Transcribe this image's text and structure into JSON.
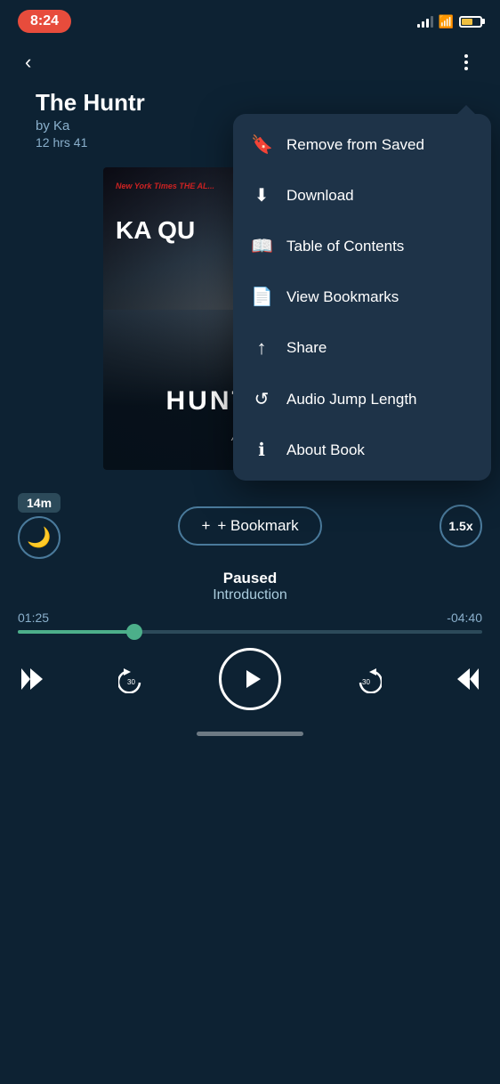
{
  "statusBar": {
    "time": "8:24",
    "batteryColor": "#f0c040"
  },
  "header": {
    "backLabel": "‹",
    "moreLabel": "⋮"
  },
  "book": {
    "title": "The Huntr",
    "fullTitle": "The Huntress",
    "author": "by Ka",
    "fullAuthor": "by Kate Quinn",
    "duration": "12 hrs 41",
    "coverTopText": "New York Times\nTHE AL...",
    "coverAuthor": "KA\nQU",
    "coverTitle": "HUNTRESS",
    "coverSubtitle": "A Novel"
  },
  "controls": {
    "sleepBadge": "14m",
    "bookmarkLabel": "+ Bookmark",
    "speedLabel": "1.5x",
    "pausedLabel": "Paused",
    "chapterLabel": "Introduction",
    "timeElapsed": "01:25",
    "timeRemaining": "-04:40",
    "progressPercent": 25
  },
  "dropdown": {
    "items": [
      {
        "id": "remove-saved",
        "icon": "🔖",
        "label": "Remove from Saved"
      },
      {
        "id": "download",
        "icon": "⬇",
        "label": "Download"
      },
      {
        "id": "toc",
        "icon": "📖",
        "label": "Table of Contents"
      },
      {
        "id": "bookmarks",
        "icon": "📄",
        "label": "View Bookmarks"
      },
      {
        "id": "share",
        "icon": "↑",
        "label": "Share"
      },
      {
        "id": "audio-jump",
        "icon": "🔄",
        "label": "Audio Jump Length"
      },
      {
        "id": "about-book",
        "icon": "ℹ",
        "label": "About Book"
      }
    ]
  }
}
